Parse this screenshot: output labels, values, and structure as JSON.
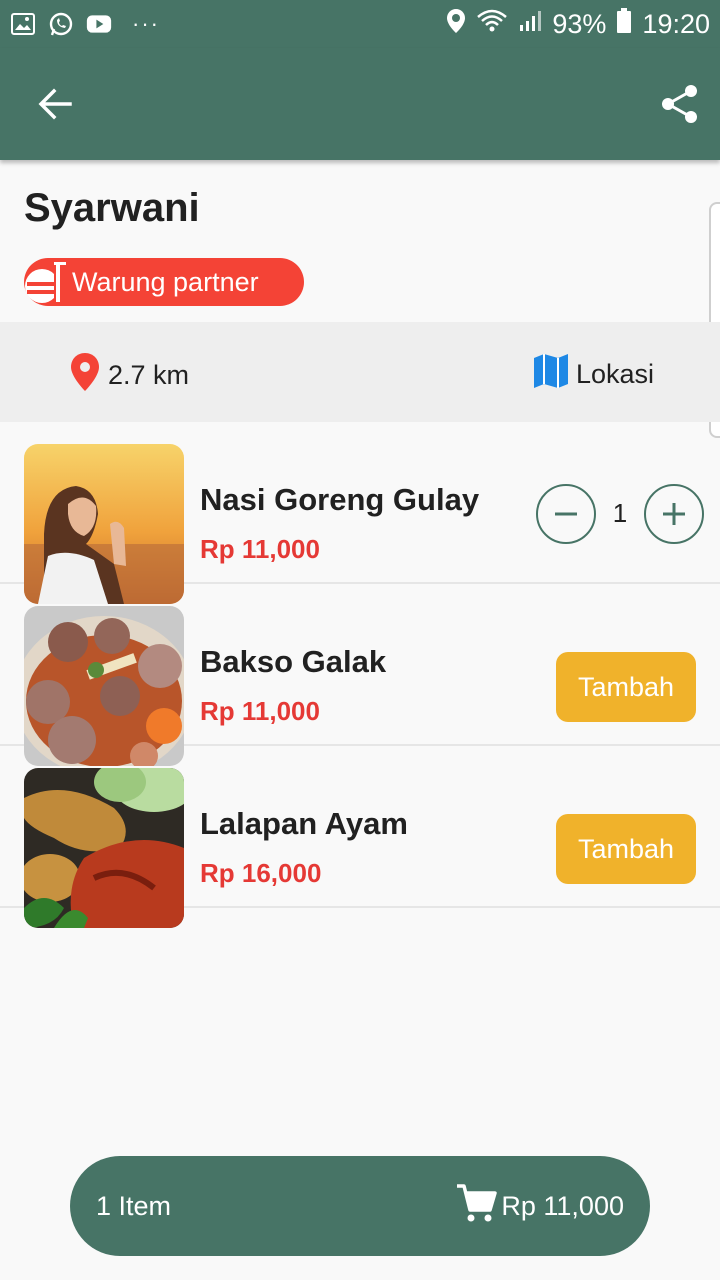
{
  "status_bar": {
    "battery": "93%",
    "time": "19:20",
    "dots": "···",
    "icons_left": [
      "image-icon",
      "whatsapp-icon",
      "youtube-icon"
    ],
    "icons_right": [
      "location-pin-icon",
      "wifi-icon",
      "signal-icon",
      "battery-icon"
    ]
  },
  "app_bar": {
    "back_icon": "arrow-back-icon",
    "share_icon": "share-icon",
    "color": "#477466"
  },
  "store": {
    "name": "Syarwani",
    "badge_label": "Warung partner",
    "badge_color": "#f44336",
    "distance": "2.7 km",
    "location_label": "Lokasi"
  },
  "menu": {
    "items": [
      {
        "name": "Nasi Goreng Gulay",
        "price": "Rp 11,000",
        "quantity": "1"
      },
      {
        "name": "Bakso Galak",
        "price": "Rp 11,000",
        "button_label": "Tambah"
      },
      {
        "name": "Lalapan Ayam",
        "price": "Rp 16,000",
        "button_label": "Tambah"
      }
    ],
    "price_color": "#e53935",
    "button_color": "#f0b22b"
  },
  "cart": {
    "count_label": "1 Item",
    "total": "Rp 11,000",
    "icon": "cart-icon"
  }
}
